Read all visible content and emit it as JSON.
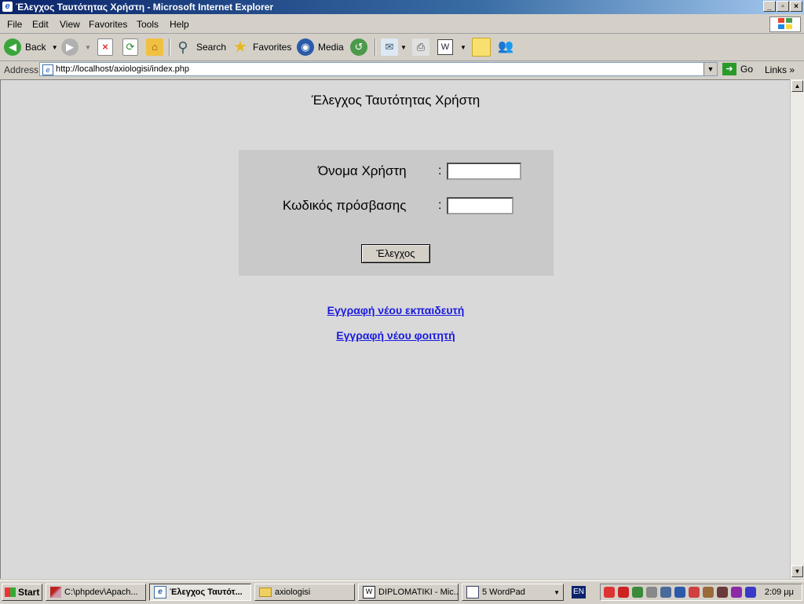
{
  "window": {
    "title": "Έλεγχος Ταυτότητας Χρήστη - Microsoft Internet Explorer",
    "controls": {
      "minimize": "_",
      "maximize": "▫",
      "close": "×"
    }
  },
  "menu": [
    "File",
    "Edit",
    "View",
    "Favorites",
    "Tools",
    "Help"
  ],
  "toolbar": {
    "back": "Back",
    "search": "Search",
    "favorites": "Favorites",
    "media": "Media"
  },
  "address": {
    "label": "Address",
    "url": "http://localhost/axiologisi/index.php",
    "go": "Go",
    "links": "Links"
  },
  "page": {
    "heading": "Έλεγχος Ταυτότητας Χρήστη",
    "form": {
      "username_label": "Όνομα Χρήστη",
      "password_label": "Κωδικός πρόσβασης",
      "colon": ":",
      "username_value": "",
      "password_value": "",
      "submit_label": "Έλεγχος"
    },
    "links": {
      "register_instructor": "Εγγραφή νέου εκπαιδευτή",
      "register_student": "Εγγραφή νέου φοιτητή"
    }
  },
  "taskbar": {
    "start": "Start",
    "tasks": [
      {
        "label": "C:\\phpdev\\Apach...",
        "active": false
      },
      {
        "label": "Έλεγχος Ταυτότ...",
        "active": true
      },
      {
        "label": "axiologisi",
        "active": false
      },
      {
        "label": "DIPLOMATIKI - Mic...",
        "active": false
      },
      {
        "label": "5 WordPad",
        "active": false
      }
    ],
    "language": "EN",
    "clock": "2:09 μμ"
  }
}
